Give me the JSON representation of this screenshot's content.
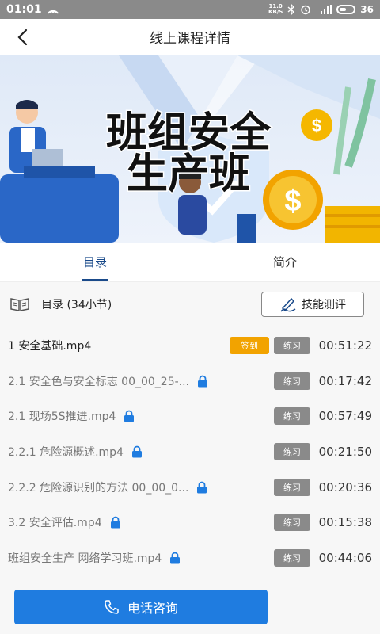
{
  "status": {
    "time": "01:01",
    "speed_line1": "11.0",
    "speed_line2": "KB/S",
    "battery": "36",
    "signal": "4G"
  },
  "nav": {
    "title": "线上课程详情"
  },
  "banner": {
    "line1": "班组安全",
    "line2": "生产班"
  },
  "tabs": [
    {
      "label": "目录",
      "active": true
    },
    {
      "label": "简介",
      "active": false
    }
  ],
  "catalog": {
    "title": "目录 (34小节)",
    "skill_button": "技能测评"
  },
  "lessons": [
    {
      "title": "1 安全基础.mp4",
      "locked": false,
      "sign": "签到",
      "practice": "练习",
      "duration": "00:51:22"
    },
    {
      "title": "2.1 安全色与安全标志 00_00_25-...",
      "locked": true,
      "practice": "练习",
      "duration": "00:17:42"
    },
    {
      "title": "2.1 现场5S推进.mp4",
      "locked": true,
      "practice": "练习",
      "duration": "00:57:49"
    },
    {
      "title": "2.2.1 危险源概述.mp4",
      "locked": true,
      "practice": "练习",
      "duration": "00:21:50"
    },
    {
      "title": "2.2.2 危险源识别的方法 00_00_0...",
      "locked": true,
      "practice": "练习",
      "duration": "00:20:36"
    },
    {
      "title": "3.2 安全评估.mp4",
      "locked": true,
      "practice": "练习",
      "duration": "00:15:38"
    },
    {
      "title": "班组安全生产 网络学习班.mp4",
      "locked": true,
      "practice": "练习",
      "duration": "00:44:06"
    }
  ],
  "call": {
    "label": "电话咨询"
  },
  "colors": {
    "accent": "#1f7ce0",
    "tab_active": "#1a4a8a",
    "sign": "#f2a300",
    "practice": "#8a8a8a"
  }
}
